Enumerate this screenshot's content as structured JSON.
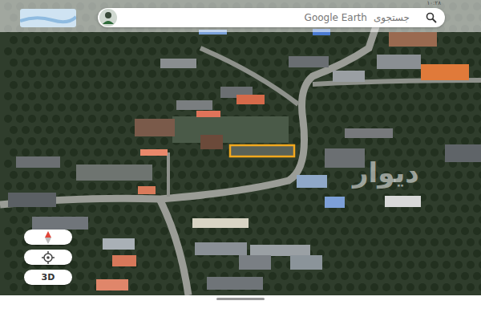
{
  "status_bar": {
    "time": "۱۰:۲۸"
  },
  "search": {
    "brand": "Google Earth",
    "placeholder": "جستجوی"
  },
  "controls": {
    "view_mode": "3D"
  },
  "watermark": "دیوار"
}
